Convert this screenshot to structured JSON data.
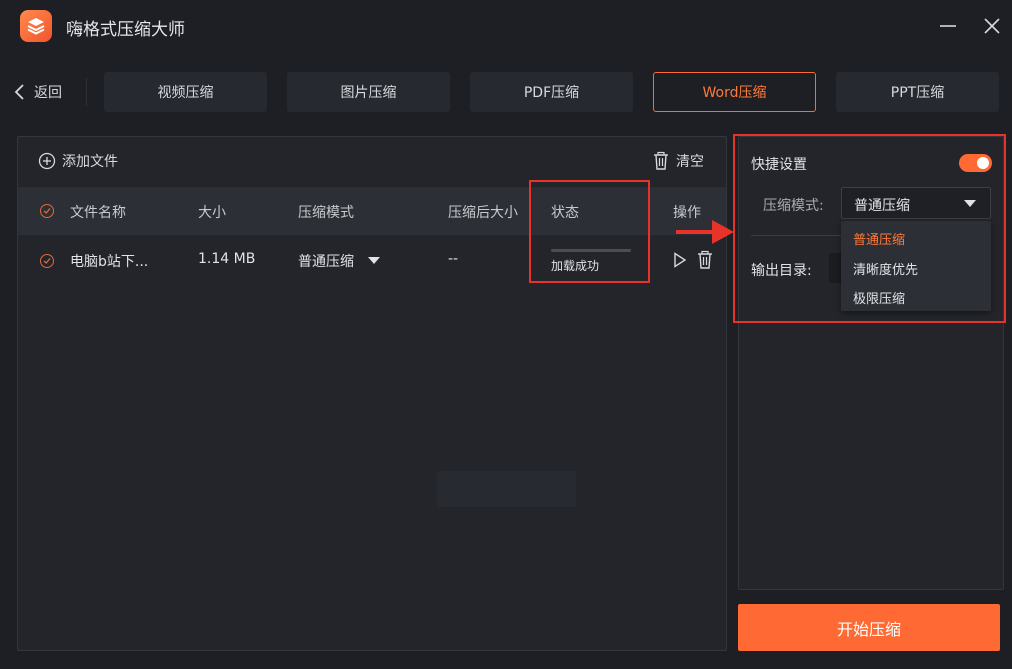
{
  "app": {
    "title": "嗨格式压缩大师"
  },
  "nav": {
    "back_label": "返回",
    "tabs": [
      {
        "label": "视频压缩"
      },
      {
        "label": "图片压缩"
      },
      {
        "label": "PDF压缩"
      },
      {
        "label": "Word压缩"
      },
      {
        "label": "PPT压缩"
      }
    ],
    "active_tab": "Word压缩"
  },
  "file_panel": {
    "add_file_label": "添加文件",
    "clear_label": "清空",
    "columns": [
      "文件名称",
      "大小",
      "压缩模式",
      "压缩后大小",
      "状态",
      "操作"
    ],
    "rows": [
      {
        "name": "电脑b站下...",
        "size": "1.14 MB",
        "mode": "普通压缩",
        "compressed_size": "--",
        "status": "加载成功"
      }
    ]
  },
  "settings": {
    "quick_settings_label": "快捷设置",
    "quick_settings_on": true,
    "mode_label": "压缩模式:",
    "mode_selected": "普通压缩",
    "mode_options": [
      "普通压缩",
      "清晰度优先",
      "极限压缩"
    ],
    "output_label": "输出目录:"
  },
  "start_button_label": "开始压缩",
  "colors": {
    "accent": "#ff6a34",
    "highlight_box": "#e8332a",
    "background": "#1d1f24"
  }
}
